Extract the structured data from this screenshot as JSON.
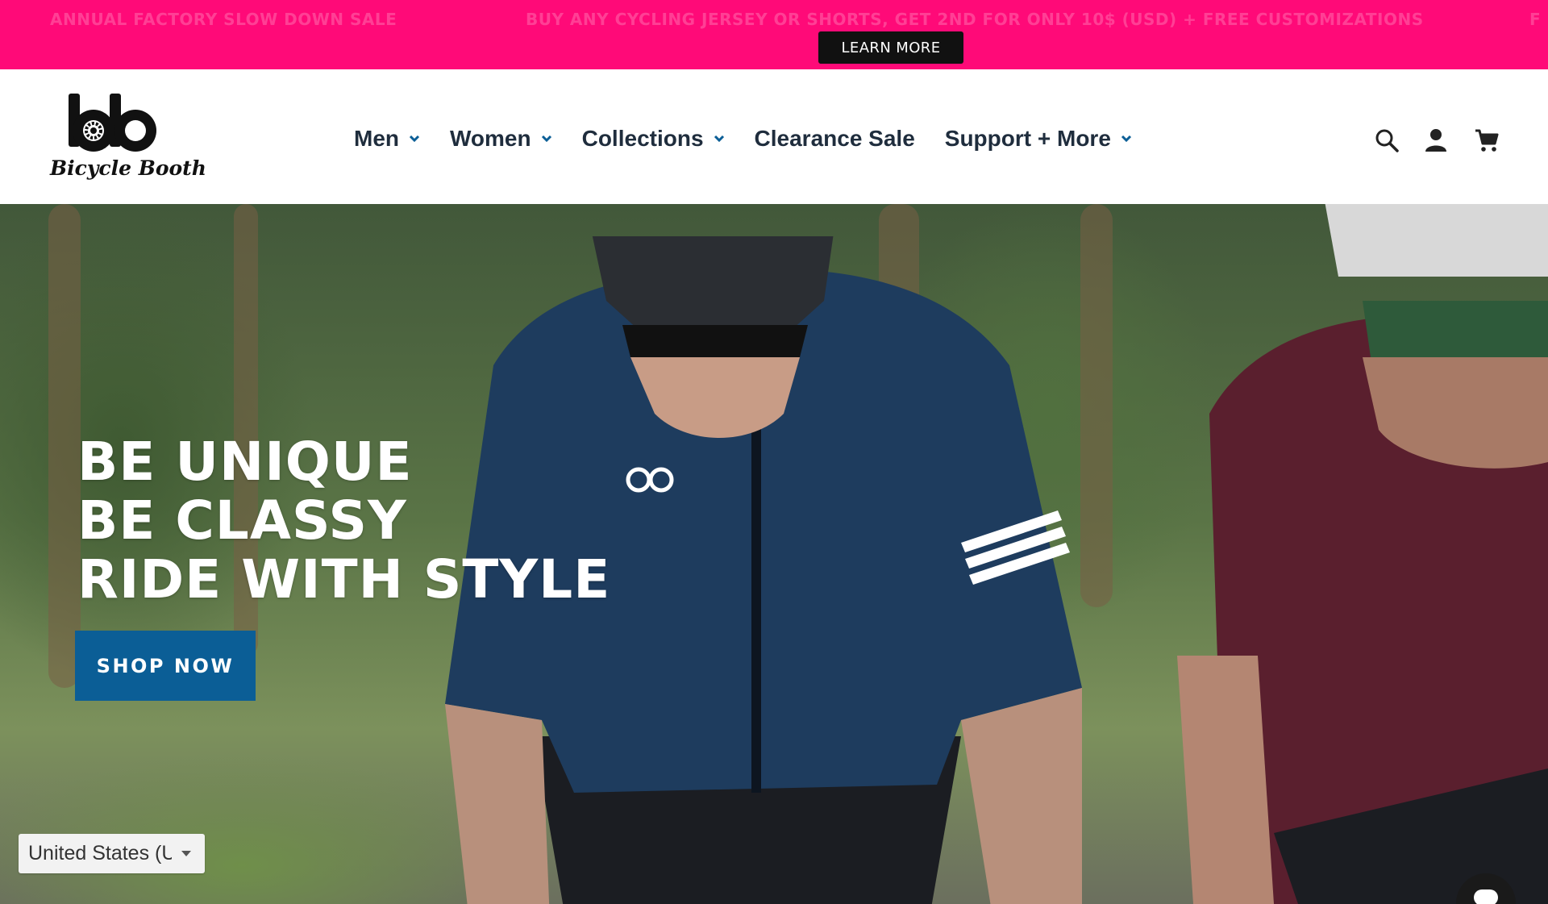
{
  "announcement": {
    "messages": [
      "ANNUAL FACTORY SLOW DOWN SALE",
      "BUY ANY CYCLING JERSEY OR SHORTS, GET 2ND FOR ONLY 10$ (USD) + FREE CUSTOMIZATIONS",
      "F"
    ],
    "button_label": "LEARN MORE",
    "background_color": "#ff0a78"
  },
  "header": {
    "logo_text": "Bicycle Booth",
    "nav": [
      {
        "label": "Men",
        "has_dropdown": true
      },
      {
        "label": "Women",
        "has_dropdown": true
      },
      {
        "label": "Collections",
        "has_dropdown": true
      },
      {
        "label": "Clearance Sale",
        "has_dropdown": false
      },
      {
        "label": "Support + More",
        "has_dropdown": true
      }
    ],
    "icons": [
      "search-icon",
      "account-icon",
      "cart-icon"
    ]
  },
  "hero": {
    "headline_lines": [
      "BE UNIQUE",
      "BE CLASSY",
      "RIDE WITH STYLE"
    ],
    "cta_label": "SHOP NOW",
    "cta_color": "#0b5e96"
  },
  "country_selector": {
    "value": "United States (U"
  },
  "colors": {
    "nav_text": "#1f2d3d",
    "chevron": "#0b5e96"
  }
}
